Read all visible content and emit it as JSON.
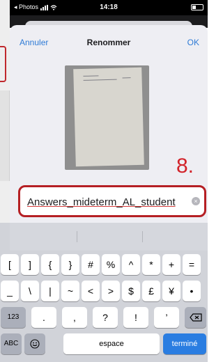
{
  "status_bar": {
    "back_label": "◂ Photos",
    "time": "14:18"
  },
  "navbar": {
    "cancel_label": "Annuler",
    "title": "Renommer",
    "ok_label": "OK"
  },
  "step_label": "8.",
  "filename_field": {
    "value": "Answers_mideterm_AL_student"
  },
  "keyboard": {
    "row1": [
      "[",
      "]",
      "{",
      "}",
      "#",
      "%",
      "^",
      "*",
      "+",
      "="
    ],
    "row2": [
      "_",
      "\\",
      "|",
      "~",
      "<",
      ">",
      "$",
      "£",
      "¥",
      "•"
    ],
    "row3_mode": "123",
    "row3": [
      ".",
      ",",
      "?",
      "!",
      "’"
    ],
    "row4_mode": "ABC",
    "space_label": "espace",
    "done_label": "terminé"
  },
  "colors": {
    "accent": "#2f7bd6",
    "highlight_red": "#b51f24",
    "done_blue": "#2a7de1"
  }
}
